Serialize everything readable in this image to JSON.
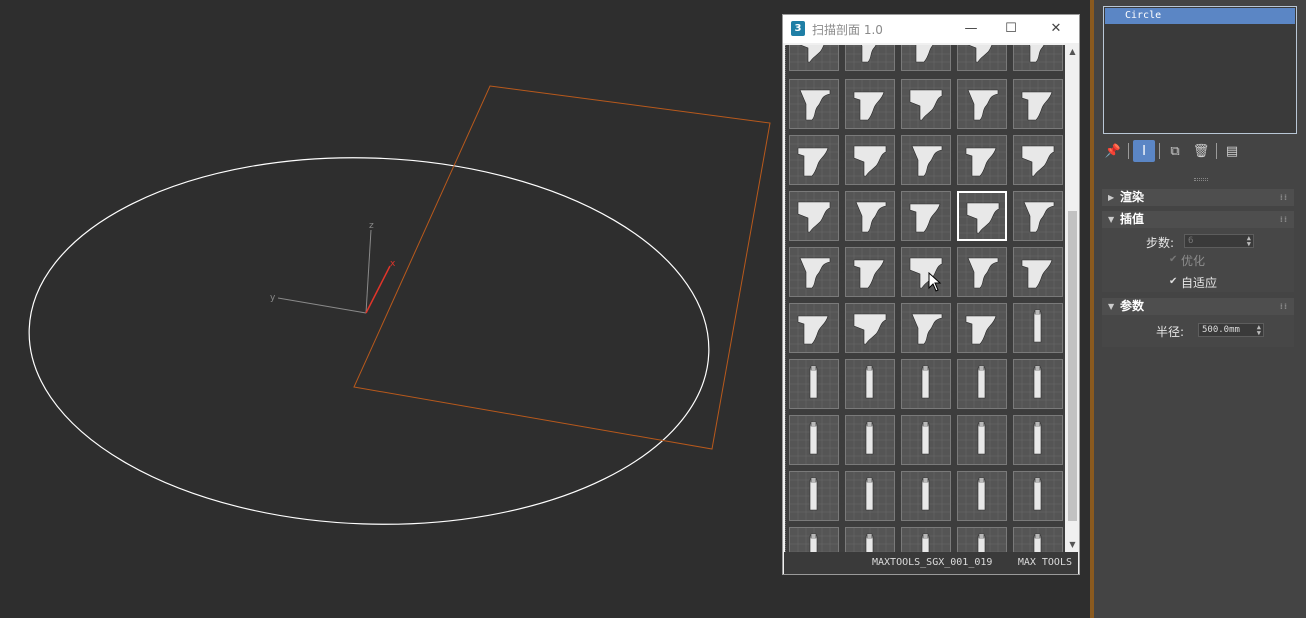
{
  "viewport": {
    "axis_labels": {
      "z": "z",
      "x": "x",
      "y": "y"
    },
    "circle_color": "#ffffff",
    "plane_color": "#b8591c"
  },
  "tool_window": {
    "title": "扫描剖面 1.0",
    "app_logo": "3",
    "controls": {
      "minimize": "—",
      "maximize": "☐",
      "close": "✕"
    },
    "status_code": "MAXTOOLS_SGX_001_019",
    "brand": "MAX TOOLS",
    "selected_thumbnail_index": 18
  },
  "command_panel": {
    "modifier_stack": [
      "Circle"
    ],
    "rollouts": {
      "render": {
        "title": "渲染"
      },
      "interpolation": {
        "title": "插值",
        "steps_label": "步数:",
        "steps_value": "6",
        "optimize_label": "优化",
        "optimize_checked": true,
        "adaptive_label": "自适应",
        "adaptive_checked": true
      },
      "parameters": {
        "title": "参数",
        "radius_label": "半径:",
        "radius_value": "500.0mm"
      }
    }
  },
  "colors": {
    "accent": "#5b86c5",
    "viewport_bg": "#2e2e2e",
    "panel_bg": "#444444"
  }
}
